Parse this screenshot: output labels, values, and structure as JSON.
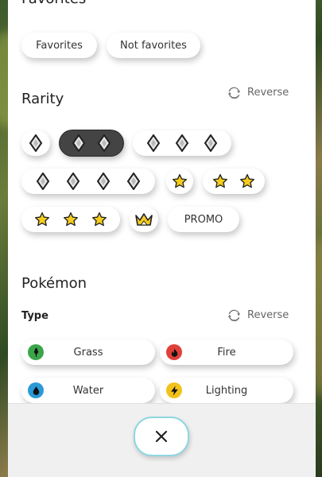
{
  "favorites": {
    "title": "Favorites",
    "options": [
      {
        "label": "Favorites"
      },
      {
        "label": "Not favorites"
      }
    ]
  },
  "rarity": {
    "title": "Rarity",
    "reverse_label": "Reverse",
    "options": [
      {
        "symbol": "diamond",
        "count": 1,
        "selected": false
      },
      {
        "symbol": "diamond",
        "count": 2,
        "selected": true
      },
      {
        "symbol": "diamond",
        "count": 3,
        "selected": false
      },
      {
        "symbol": "diamond",
        "count": 4,
        "selected": false
      },
      {
        "symbol": "star",
        "count": 1,
        "selected": false
      },
      {
        "symbol": "star",
        "count": 2,
        "selected": false
      },
      {
        "symbol": "star",
        "count": 3,
        "selected": false
      },
      {
        "symbol": "crown",
        "count": 1,
        "selected": false
      },
      {
        "label": "PROMO",
        "selected": false
      }
    ]
  },
  "pokemon": {
    "title": "Pokémon",
    "type_title": "Type",
    "reverse_label": "Reverse",
    "types": [
      {
        "label": "Grass",
        "icon": "leaf-icon",
        "color": "#3aa54a"
      },
      {
        "label": "Fire",
        "icon": "flame-icon",
        "color": "#e0403a"
      },
      {
        "label": "Water",
        "icon": "water-drop-icon",
        "color": "#2a9ad8"
      },
      {
        "label": "Lighting",
        "icon": "lightning-icon",
        "color": "#f2c21b"
      }
    ]
  },
  "footer": {
    "close_icon": "close-icon"
  },
  "colors": {
    "accent": "#8fd6e3",
    "selected_pill": "#444444"
  }
}
